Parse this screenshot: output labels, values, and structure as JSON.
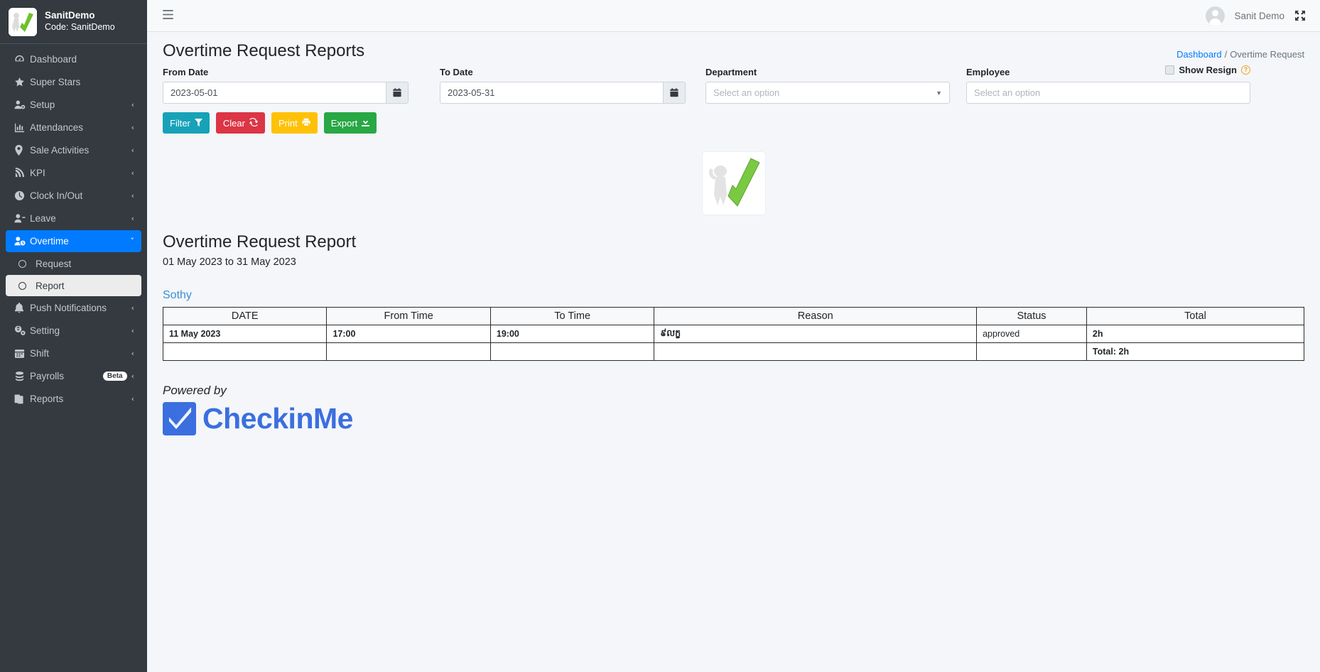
{
  "brand": {
    "name": "SanitDemo",
    "code": "Code: SanitDemo",
    "logo_icon": "green-check-mascot-logo"
  },
  "sidebar": {
    "items": [
      {
        "label": "Dashboard",
        "icon": "dashboard-icon",
        "caret": "",
        "active": false
      },
      {
        "label": "Super Stars",
        "icon": "star-icon",
        "caret": "",
        "active": false
      },
      {
        "label": "Setup",
        "icon": "user-gear-icon",
        "caret": "‹",
        "active": false
      },
      {
        "label": "Attendances",
        "icon": "bar-chart-icon",
        "caret": "‹",
        "active": false
      },
      {
        "label": "Sale Activities",
        "icon": "map-pin-icon",
        "caret": "‹",
        "active": false
      },
      {
        "label": "KPI",
        "icon": "signal-icon",
        "caret": "‹",
        "active": false
      },
      {
        "label": "Clock In/Out",
        "icon": "clock-icon",
        "caret": "‹",
        "active": false
      },
      {
        "label": "Leave",
        "icon": "user-minus-icon",
        "caret": "‹",
        "active": false
      },
      {
        "label": "Overtime",
        "icon": "user-clock-icon",
        "caret": "˅",
        "active": true
      }
    ],
    "overtime_subitems": [
      {
        "label": "Request",
        "icon": "circle-icon",
        "selected": false
      },
      {
        "label": "Report",
        "icon": "circle-icon",
        "selected": true
      }
    ],
    "items_after": [
      {
        "label": "Push Notifications",
        "icon": "bell-icon",
        "caret": "‹",
        "badge": ""
      },
      {
        "label": "Setting",
        "icon": "gears-icon",
        "caret": "‹",
        "badge": ""
      },
      {
        "label": "Shift",
        "icon": "calendar-icon",
        "caret": "‹",
        "badge": ""
      },
      {
        "label": "Payrolls",
        "icon": "coins-icon",
        "caret": "‹",
        "badge": "Beta"
      },
      {
        "label": "Reports",
        "icon": "clipboard-icon",
        "caret": "‹",
        "badge": ""
      }
    ]
  },
  "topbar": {
    "hamburger_icon": "hamburger-menu-icon",
    "username": "Sanit Demo",
    "avatar_icon": "user-avatar-icon",
    "expand_icon": "fullscreen-expand-icon"
  },
  "header": {
    "title": "Overtime Request Reports",
    "breadcrumb_home": "Dashboard",
    "breadcrumb_sep": "/",
    "breadcrumb_current": "Overtime Request"
  },
  "filters": {
    "from_date_label": "From Date",
    "from_date_value": "2023-05-01",
    "to_date_label": "To Date",
    "to_date_value": "2023-05-31",
    "department_label": "Department",
    "department_placeholder": "Select an option",
    "employee_label": "Employee",
    "employee_placeholder": "Select an option",
    "show_resign_label": "Show Resign",
    "help_icon_glyph": "?",
    "calendar_icon": "calendar-icon"
  },
  "buttons": {
    "filter": "Filter",
    "clear": "Clear",
    "print": "Print",
    "export": "Export",
    "filter_color": "#17a2b8",
    "clear_color": "#dc3545",
    "print_color": "#ffc107",
    "export_color": "#28a745"
  },
  "report": {
    "logo_icon": "green-check-mascot-logo",
    "title": "Overtime Request Report",
    "date_range": "01 May 2023 to 31 May 2023",
    "employee_name": "Sothy",
    "columns": [
      "DATE",
      "From Time",
      "To Time",
      "Reason",
      "Status",
      "Total"
    ],
    "rows": [
      {
        "date": "11 May 2023",
        "from_time": "17:00",
        "to_time": "19:00",
        "reason": "៩លក្ខ",
        "status": "approved",
        "total": "2h"
      }
    ],
    "grand_total": "Total: 2h"
  },
  "footer": {
    "powered_by": "Powered by",
    "product_name": "CheckinMe",
    "product_logo_icon": "checkinme-check-logo",
    "brand_color": "#3b6fe0"
  }
}
